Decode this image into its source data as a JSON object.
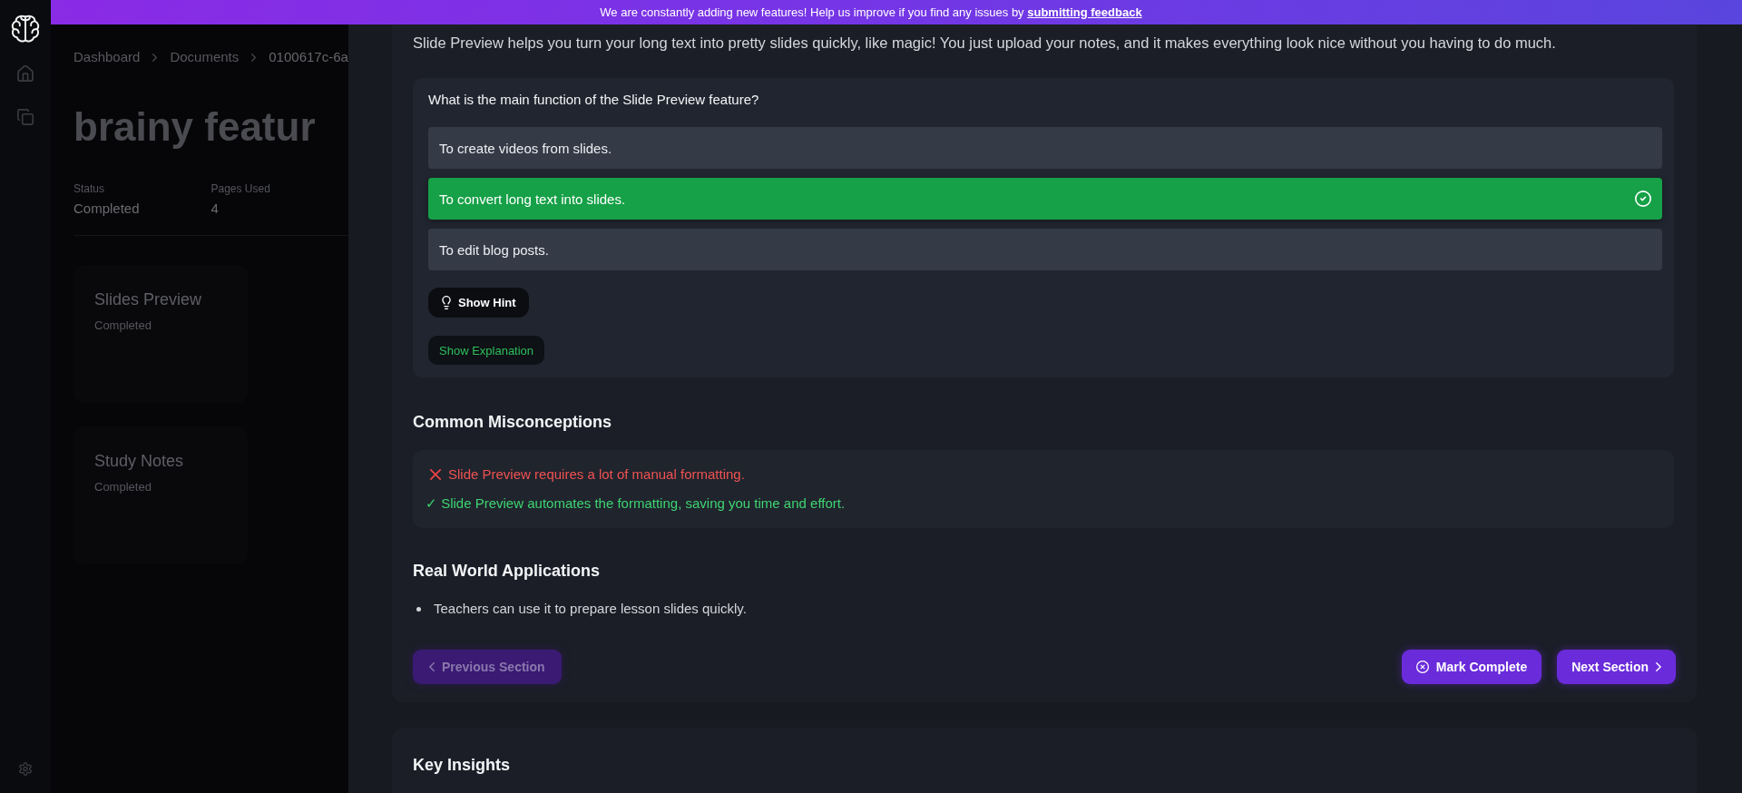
{
  "banner": {
    "text": "We are constantly adding new features! Help us improve if you find any issues by",
    "link": "submitting feedback"
  },
  "background_page": {
    "breadcrumb": [
      "Dashboard",
      "Documents",
      "0100617c-6a"
    ],
    "title": "brainy featur",
    "stats": [
      {
        "label": "Status",
        "value": "Completed"
      },
      {
        "label": "Pages Used",
        "value": "4"
      }
    ],
    "cards": [
      {
        "title": "Slides Preview",
        "status": "Completed"
      },
      {
        "title": "Study Notes",
        "status": "Completed"
      }
    ]
  },
  "panel": {
    "intro": "Slide Preview helps you turn your long text into pretty slides quickly, like magic! You just upload your notes, and it makes everything look nice without you having to do much.",
    "quiz": {
      "question": "What is the main function of the Slide Preview feature?",
      "options": [
        {
          "text": "To create videos from slides.",
          "selected": false
        },
        {
          "text": "To convert long text into slides.",
          "selected": true
        },
        {
          "text": "To edit blog posts.",
          "selected": false
        }
      ],
      "hint_button": "Show Hint",
      "explanation_button": "Show Explanation"
    },
    "misconceptions": {
      "heading": "Common Misconceptions",
      "items": [
        {
          "kind": "myth",
          "text": "Slide Preview requires a lot of manual formatting."
        },
        {
          "kind": "fact",
          "text": "✓ Slide Preview automates the formatting, saving you time and effort."
        }
      ]
    },
    "applications": {
      "heading": "Real World Applications",
      "items": [
        "Teachers can use it to prepare lesson slides quickly."
      ]
    },
    "navigation": {
      "previous": {
        "label": "Previous Section",
        "disabled": true
      },
      "mark_complete": "Mark Complete",
      "next": "Next Section"
    },
    "next_section": {
      "heading": "Key Insights"
    }
  }
}
